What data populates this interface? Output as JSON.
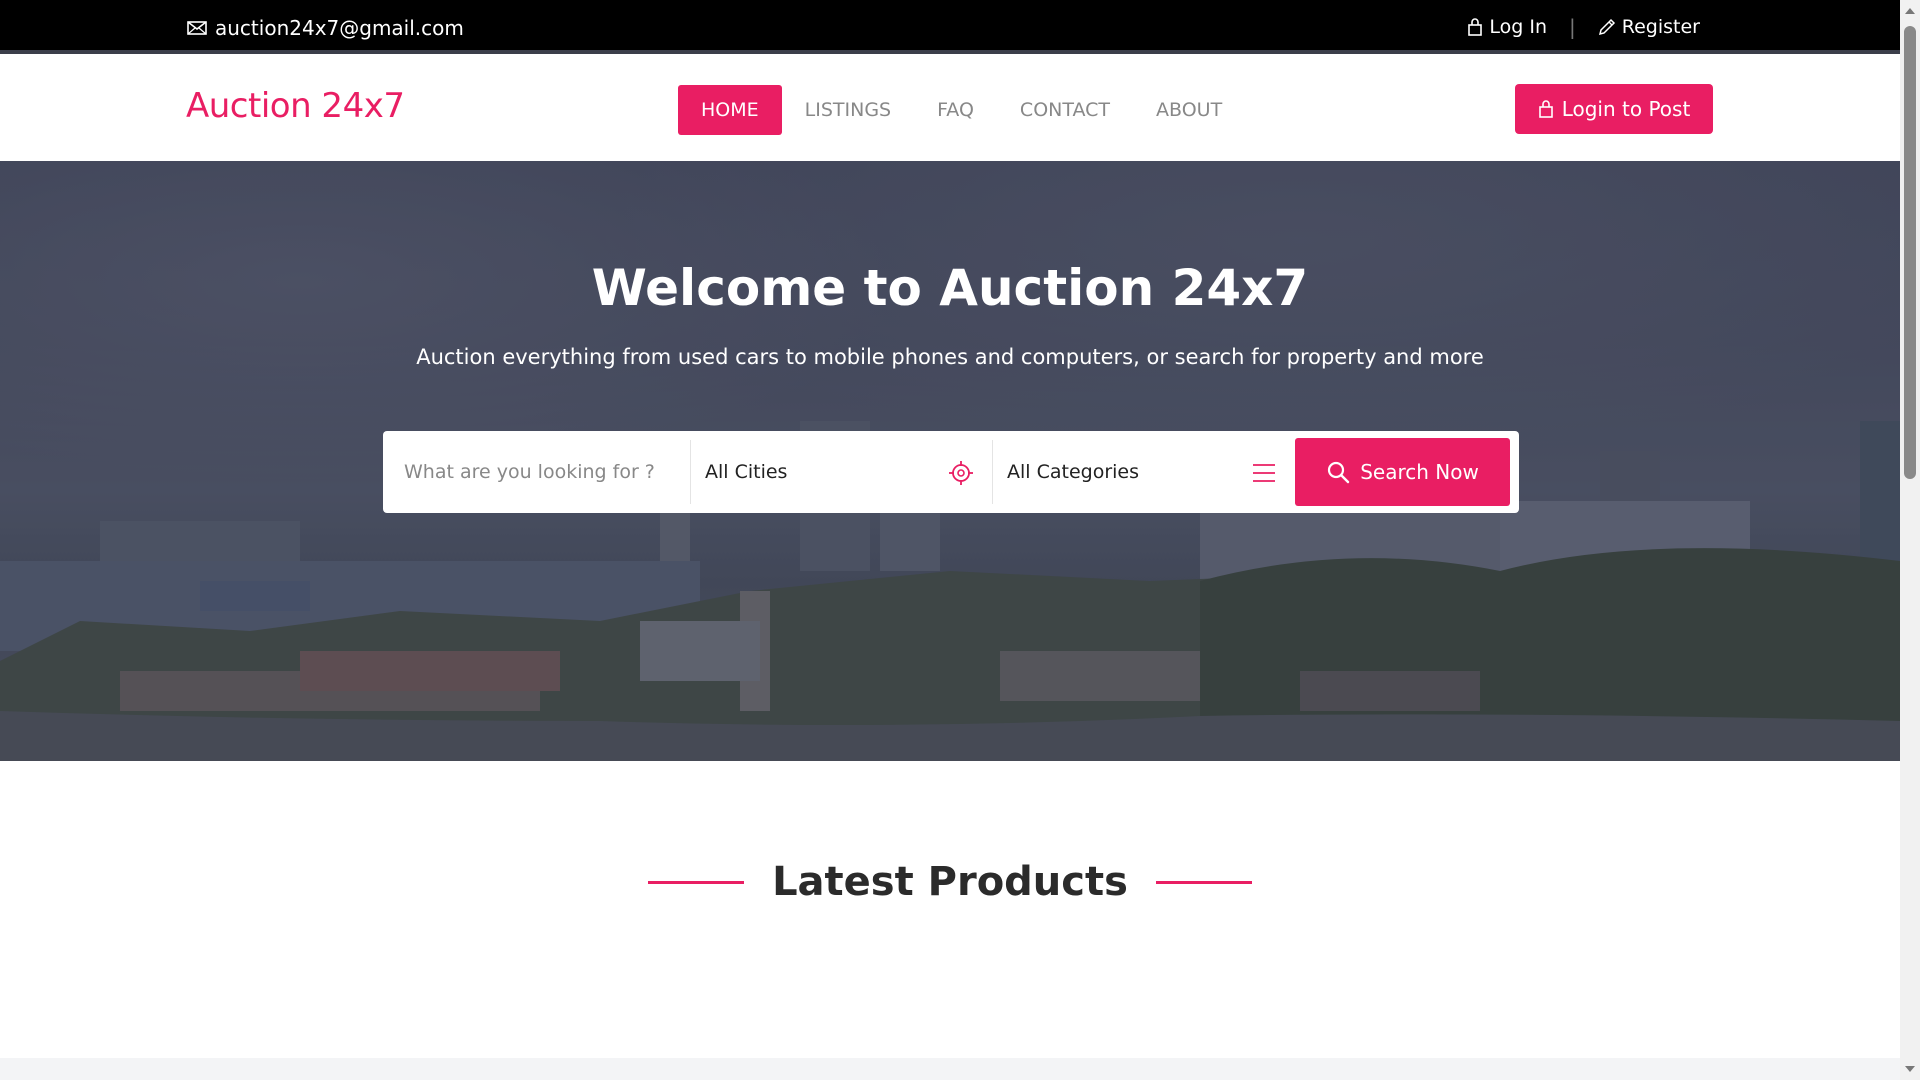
{
  "topbar": {
    "email": "auction24x7@gmail.com",
    "login_label": "Log In",
    "separator": "|",
    "register_label": "Register"
  },
  "header": {
    "logo": "Auction 24x7",
    "nav": [
      {
        "label": "HOME",
        "active": true
      },
      {
        "label": "LISTINGS",
        "active": false
      },
      {
        "label": "FAQ",
        "active": false
      },
      {
        "label": "CONTACT",
        "active": false
      },
      {
        "label": "ABOUT",
        "active": false
      }
    ],
    "post_button": "Login to Post"
  },
  "hero": {
    "title": "Welcome to Auction 24x7",
    "subtitle": "Auction everything from used cars to mobile phones and computers, or search for property and more",
    "search": {
      "placeholder": "What are you looking for ?",
      "city": "All Cities",
      "category": "All Categories",
      "button": "Search Now"
    }
  },
  "latest": {
    "title": "Latest Products"
  },
  "colors": {
    "accent": "#e91e63",
    "topbar_bg": "#000000"
  },
  "icons": {
    "email": "envelope-icon",
    "login": "lock-icon",
    "register": "pencil-icon",
    "city": "crosshair-icon",
    "category": "menu-lines-icon",
    "search": "magnifier-icon"
  }
}
